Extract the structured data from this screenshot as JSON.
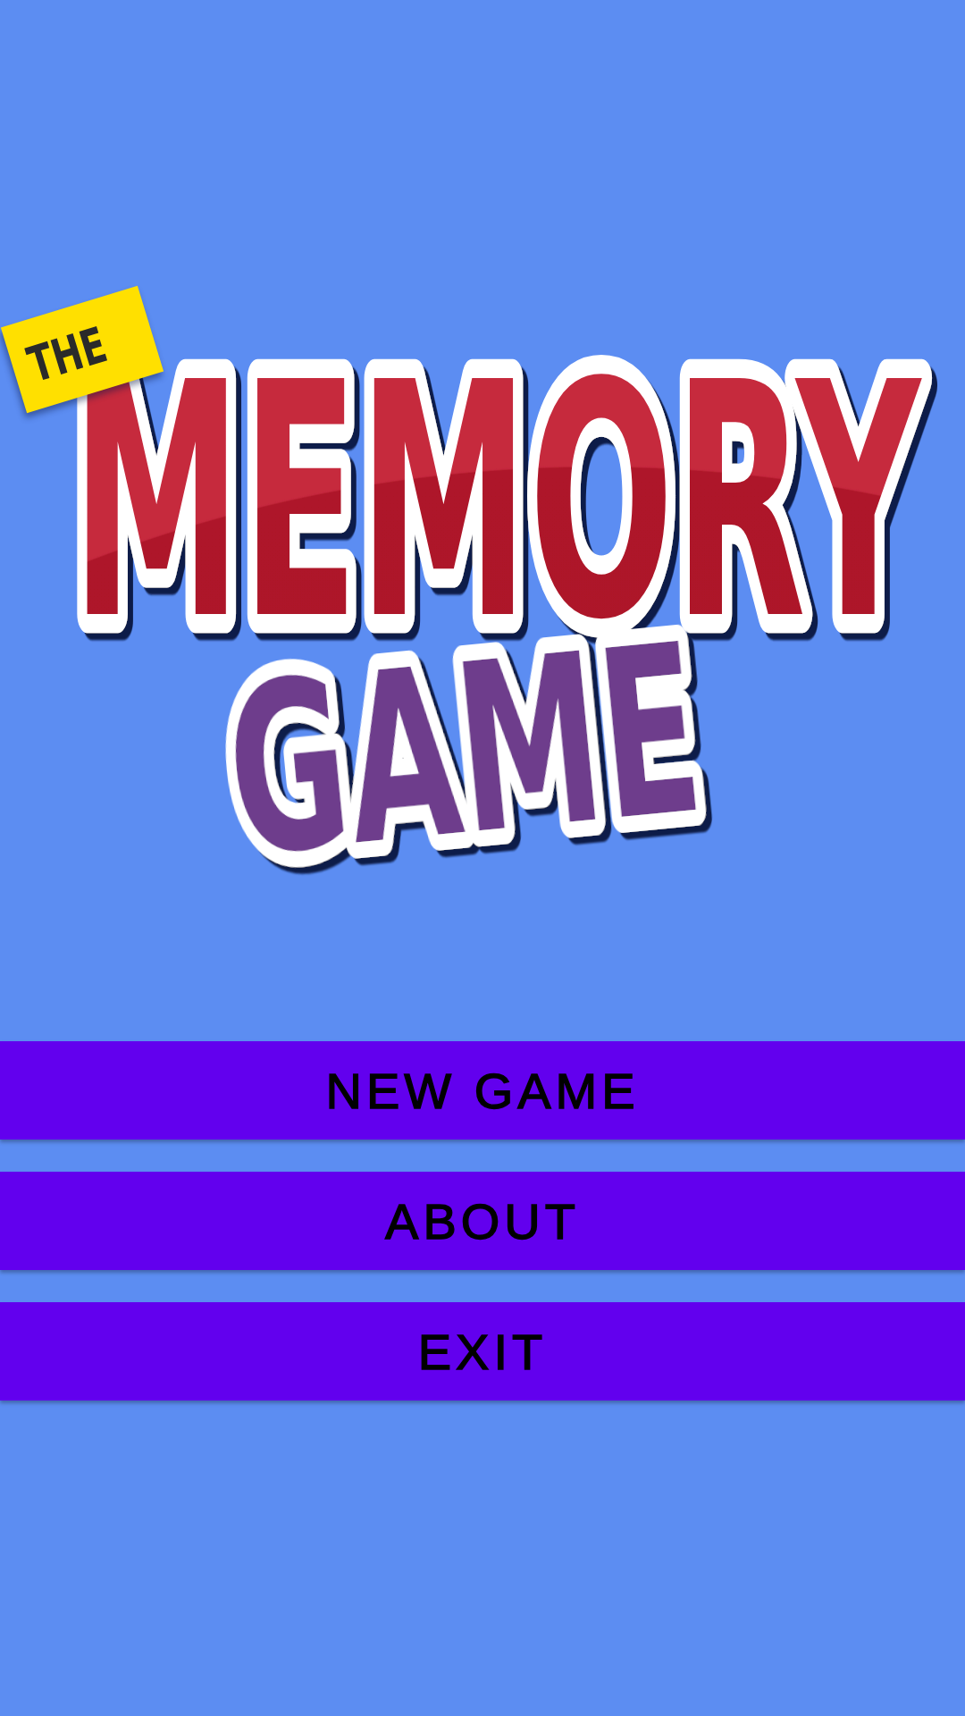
{
  "logo": {
    "tag": "THE",
    "title": "MEMORY",
    "subtitle": "GAME"
  },
  "menu": [
    {
      "label": "NEW GAME"
    },
    {
      "label": "ABOUT"
    },
    {
      "label": "EXIT"
    }
  ]
}
